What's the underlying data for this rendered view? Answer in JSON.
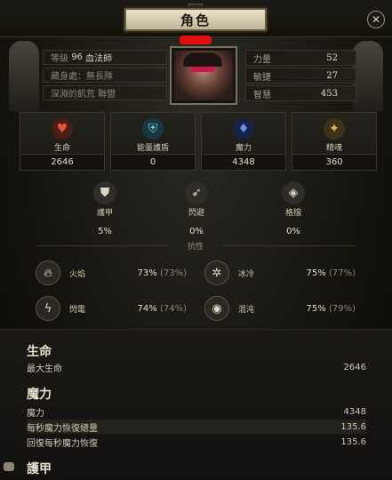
{
  "window": {
    "title": "角色",
    "close_icon": "close-icon"
  },
  "header": {
    "info": [
      {
        "label": "等級",
        "value": "96",
        "class_name": "血法師"
      },
      {
        "label": "藏身處：",
        "value": "無長隊"
      },
      {
        "label": "深淵的飢荒 聯盟"
      }
    ],
    "attributes": [
      {
        "label": "力量",
        "value": "52"
      },
      {
        "label": "敏捷",
        "value": "27"
      },
      {
        "label": "智慧",
        "value": "453"
      }
    ]
  },
  "stats": [
    {
      "label": "生命",
      "value": "2646",
      "icon": "heart-icon",
      "color": "#c0442e"
    },
    {
      "label": "能量護盾",
      "value": "0",
      "icon": "shield-icon",
      "color": "#4f9fb8"
    },
    {
      "label": "魔力",
      "value": "4348",
      "icon": "mana-icon",
      "color": "#3a62c9"
    },
    {
      "label": "精魂",
      "value": "360",
      "icon": "spirit-icon",
      "color": "#c8a24a"
    }
  ],
  "defenses": [
    {
      "label": "護甲",
      "value": "5%",
      "icon": "armour-icon"
    },
    {
      "label": "閃避",
      "value": "0%",
      "icon": "evasion-icon"
    },
    {
      "label": "格擋",
      "value": "0%",
      "icon": "block-icon"
    }
  ],
  "resist_header": "抗性",
  "resistances": [
    {
      "label": "火焰",
      "value": "73%",
      "cap": "(73%)",
      "icon": "fire-icon"
    },
    {
      "label": "冰冷",
      "value": "75%",
      "cap": "(77%)",
      "icon": "cold-icon"
    },
    {
      "label": "閃電",
      "value": "74%",
      "cap": "(74%)",
      "icon": "lightning-icon"
    },
    {
      "label": "混沌",
      "value": "75%",
      "cap": "(79%)",
      "icon": "chaos-icon"
    }
  ],
  "details": {
    "life": {
      "title": "生命",
      "rows": [
        {
          "label": "最大生命",
          "value": "2646"
        }
      ]
    },
    "mana": {
      "title": "魔力",
      "rows": [
        {
          "label": "魔力",
          "value": "4348"
        },
        {
          "label": "每秒魔力恢復總量",
          "value": "135.6"
        },
        {
          "label": "回復每秒魔力恢復",
          "value": "135.6"
        }
      ]
    },
    "armour": {
      "title": "護甲"
    }
  }
}
